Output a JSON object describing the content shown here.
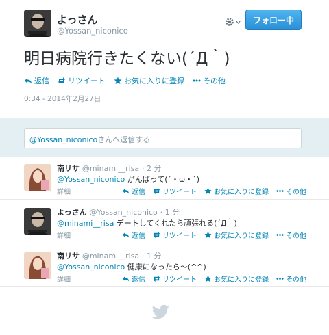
{
  "colors": {
    "link": "#0084b4",
    "muted": "#8899a6",
    "follow_button": "#2a8fd6",
    "reply_bg": "#e3eff3"
  },
  "tweet": {
    "author_name": "よっさん",
    "author_handle": "@Yossan_niconico",
    "follow_label": "フォロー中",
    "text": "明日病院行きたくない(´Д｀)",
    "actions": {
      "reply": "返信",
      "retweet": "リツイート",
      "favorite": "お気に入りに登録",
      "more": "その他"
    },
    "timestamp": "0:34 - 2014年2月27日"
  },
  "reply_box": {
    "mention": "@Yossan_niconico",
    "suffix": "さんへ返信する"
  },
  "replies": [
    {
      "name": "南リサ",
      "handle": "@minami__risa",
      "time": "2 分",
      "mention": "@Yossan_niconico",
      "text": " がんばって(´・ω・`)",
      "detail": "詳細"
    },
    {
      "name": "よっさん",
      "handle": "@Yossan_niconico",
      "time": "1 分",
      "mention": "@minami__risa",
      "text": " デートしてくれたら頑張れる(´Д｀)",
      "detail": "詳細"
    },
    {
      "name": "南リサ",
      "handle": "@minami__risa",
      "time": "1 分",
      "mention": "@Yossan_niconico",
      "text": " 健康になったら〜(^^)",
      "detail": "詳細"
    }
  ],
  "reply_actions": {
    "reply": "返信",
    "retweet": "リツイート",
    "favorite": "お気に入りに登録",
    "more": "その他"
  }
}
